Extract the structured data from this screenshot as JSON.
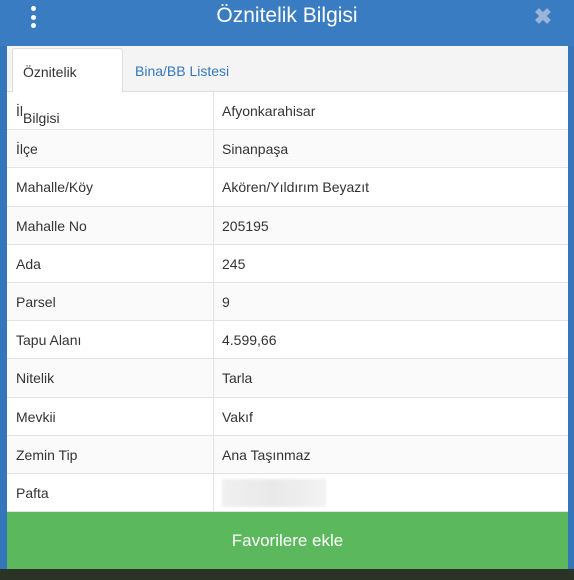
{
  "header": {
    "title": "Öznitelik Bilgisi",
    "menu_icon": "kebab-menu-icon",
    "close_icon": "close-icon"
  },
  "tabs": [
    {
      "label": "Öznitelik Bilgisi",
      "active": true
    },
    {
      "label": "Bina/BB Listesi",
      "active": false
    }
  ],
  "attributes": [
    {
      "key": "İl",
      "value": "Afyonkarahisar"
    },
    {
      "key": "İlçe",
      "value": "Sinanpaşa"
    },
    {
      "key": "Mahalle/Köy",
      "value": "Akören/Yıldırım Beyazıt"
    },
    {
      "key": "Mahalle No",
      "value": "205195"
    },
    {
      "key": "Ada",
      "value": "245"
    },
    {
      "key": "Parsel",
      "value": "9"
    },
    {
      "key": "Tapu Alanı",
      "value": "4.599,66"
    },
    {
      "key": "Nitelik",
      "value": "Tarla"
    },
    {
      "key": "Mevkii",
      "value": "Vakıf"
    },
    {
      "key": "Zemin Tip",
      "value": "Ana Taşınmaz"
    },
    {
      "key": "Pafta",
      "value": ""
    }
  ],
  "footer": {
    "favorite_label": "Favorilere ekle"
  },
  "colors": {
    "header": "#3a7cc1",
    "tab_link": "#3478b8",
    "favorite_button": "#5cb85c"
  }
}
